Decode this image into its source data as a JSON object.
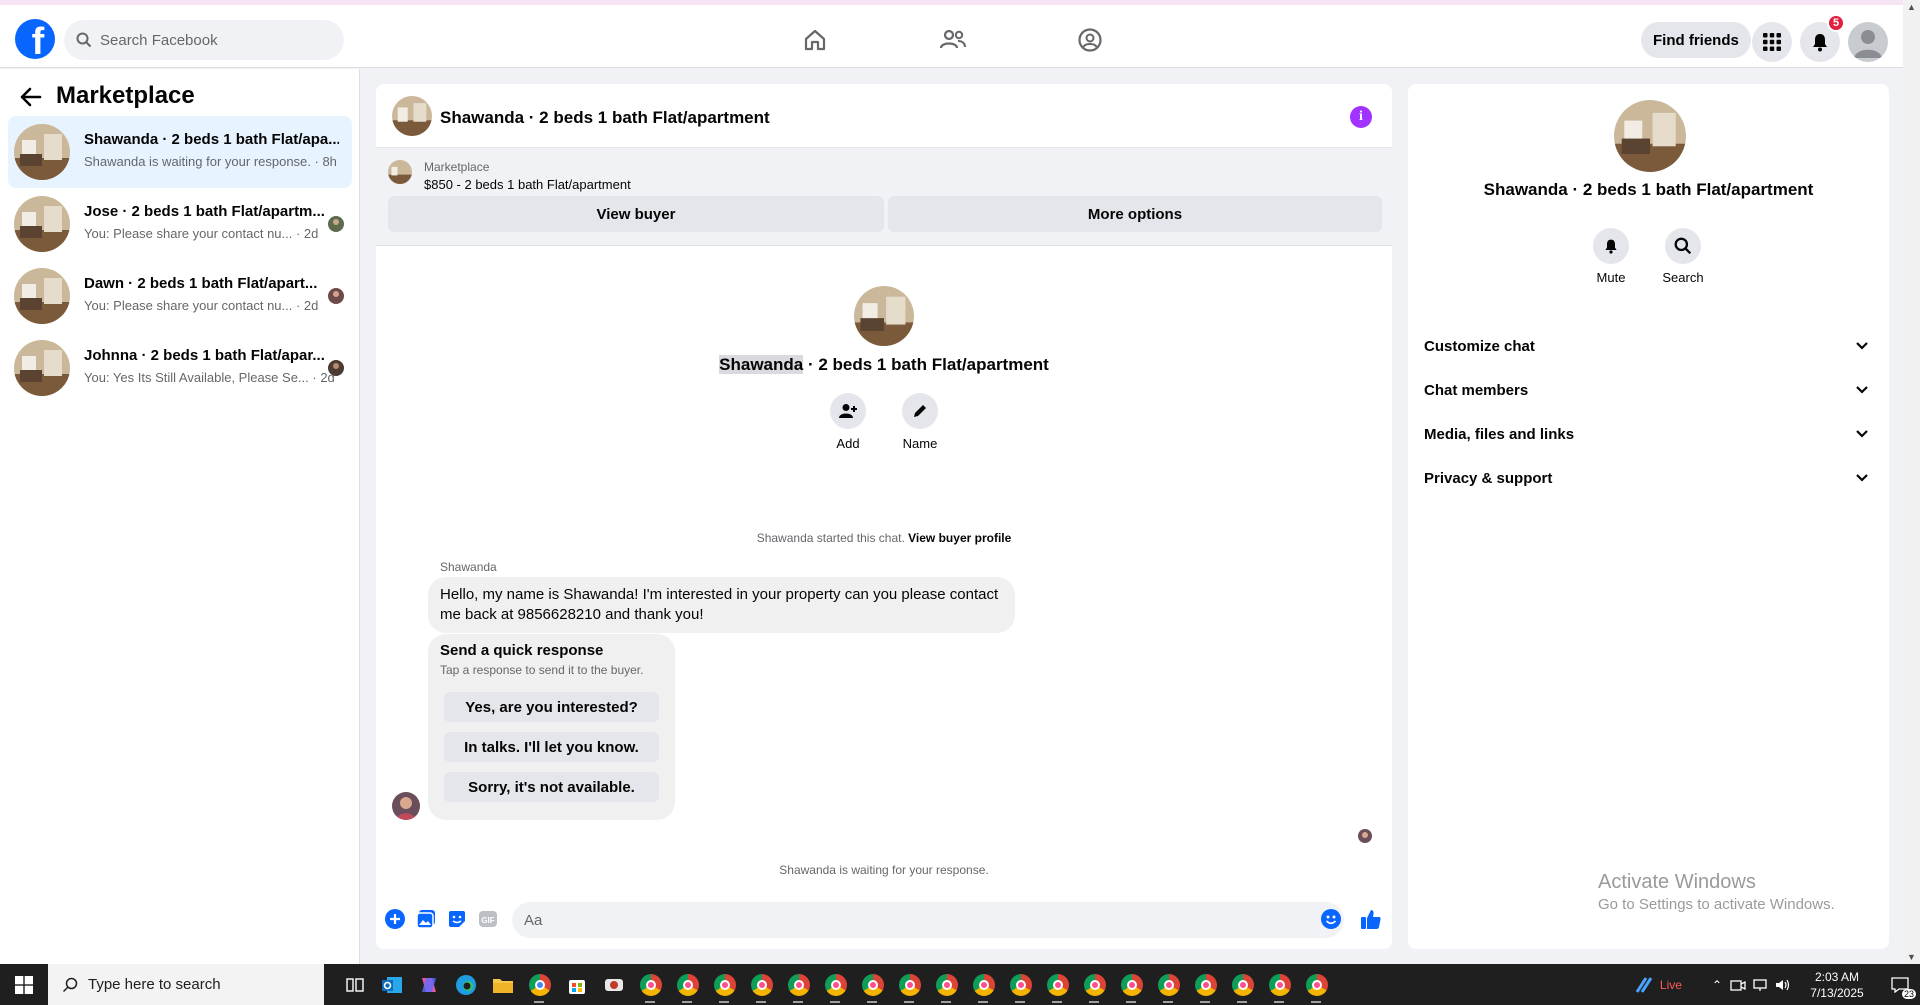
{
  "topbar": {
    "search_placeholder": "Search Facebook",
    "find_friends": "Find friends",
    "notification_count": "5"
  },
  "sidebar": {
    "title": "Marketplace",
    "conversations": [
      {
        "title": "Shawanda · 2 beds 1 bath Flat/apa...",
        "preview": "Shawanda is waiting for your response. · 8h"
      },
      {
        "title": "Jose · 2 beds 1 bath Flat/apartm...",
        "preview": "You: Please share your contact nu... · 2d"
      },
      {
        "title": "Dawn · 2 beds 1 bath Flat/apart...",
        "preview": "You: Please share your contact nu... · 2d"
      },
      {
        "title": "Johnna · 2 beds 1 bath Flat/apar...",
        "preview": "You: Yes Its Still Available, Please Se... · 2d"
      }
    ]
  },
  "chat": {
    "header_title": "Shawanda · 2 beds 1 bath Flat/apartment",
    "marketplace_label": "Marketplace",
    "listing": "$850 - 2 beds 1 bath Flat/apartment",
    "view_buyer": "View buyer",
    "more_options": "More options",
    "intro_name_highlight": "Shawanda",
    "intro_name_rest": " · 2 beds 1 bath Flat/apartment",
    "add_label": "Add",
    "name_label": "Name",
    "started_text": "Shawanda started this chat. ",
    "view_buyer_profile": "View buyer profile",
    "sender_name": "Shawanda",
    "message": "Hello, my name is Shawanda! I'm interested in your property can you please contact me back at 9856628210 and thank you!",
    "quick_title": "Send a quick response",
    "quick_sub": "Tap a response to send it to the buyer.",
    "quick_responses": [
      "Yes, are you interested?",
      "In talks. I'll let you know.",
      "Sorry, it's not available."
    ],
    "waiting_text": "Shawanda is waiting for your response.",
    "composer_placeholder": "Aa"
  },
  "details": {
    "name": "Shawanda · 2 beds 1 bath Flat/apartment",
    "mute": "Mute",
    "search": "Search",
    "sections": [
      "Customize chat",
      "Chat members",
      "Media, files and links",
      "Privacy & support"
    ]
  },
  "watermark": {
    "line1": "Activate Windows",
    "line2": "Go to Settings to activate Windows."
  },
  "taskbar": {
    "search_text": "Type here to search",
    "live": "Live",
    "time": "2:03 AM",
    "date": "7/13/2025",
    "notif": "23"
  },
  "colors": {
    "brand": "#0866ff",
    "info": "#a033ff",
    "badge": "#e41e3f"
  }
}
